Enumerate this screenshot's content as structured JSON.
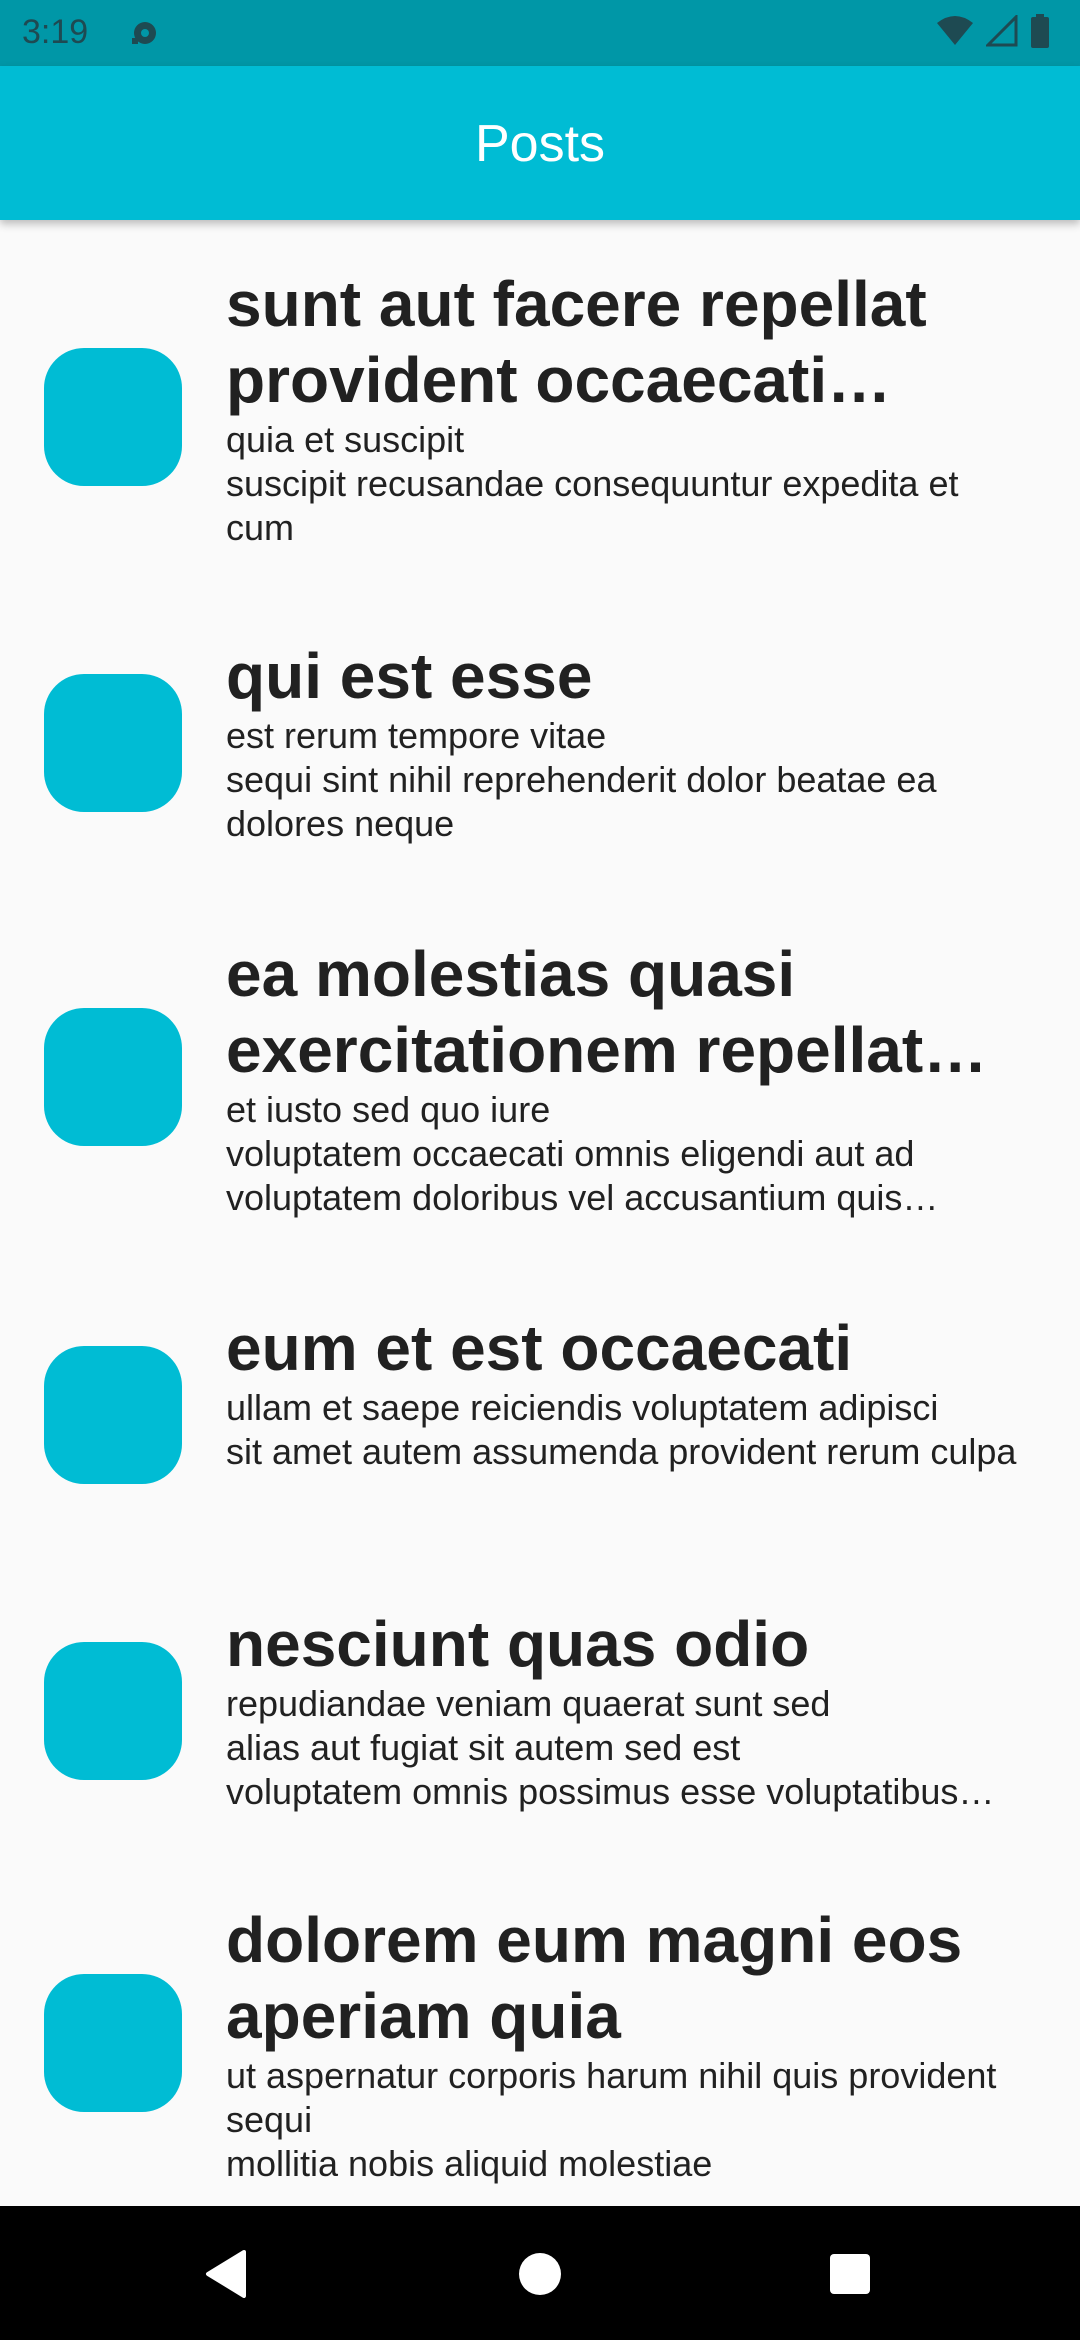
{
  "status_bar": {
    "time": "3:19",
    "icons": [
      "notification-icon",
      "wifi-icon",
      "signal-icon",
      "battery-icon"
    ]
  },
  "app_bar": {
    "title": "Posts"
  },
  "colors": {
    "primary": "#00bcd4",
    "status_bar": "#0097a7",
    "background": "#fafafa",
    "text": "#212121"
  },
  "posts": [
    {
      "title": "sunt aut facere repellat provident occaecati excepturi optio reprehenderit",
      "body": "quia et suscipit\nsuscipit recusandae consequuntur expedita et cum"
    },
    {
      "title": "qui est esse",
      "body": "est rerum tempore vitae\nsequi sint nihil reprehenderit dolor beatae ea dolores neque"
    },
    {
      "title": "ea molestias quasi exercitationem repellat qui ipsa sit aut",
      "body": "et iusto sed quo iure\nvoluptatem occaecati omnis eligendi aut ad\nvoluptatem doloribus vel accusantium quis pariatur"
    },
    {
      "title": "eum et est occaecati",
      "body": "ullam et saepe reiciendis voluptatem adipisci\nsit amet autem assumenda provident rerum culpa"
    },
    {
      "title": "nesciunt quas odio",
      "body": "repudiandae veniam quaerat sunt sed\nalias aut fugiat sit autem sed est\nvoluptatem omnis possimus esse voluptatibus quis"
    },
    {
      "title": "dolorem eum magni eos aperiam quia",
      "body": "ut aspernatur corporis harum nihil quis provident sequi\nmollitia nobis aliquid molestiae"
    }
  ],
  "nav_bar": {
    "buttons": [
      "back-icon",
      "home-icon",
      "recents-icon"
    ]
  }
}
